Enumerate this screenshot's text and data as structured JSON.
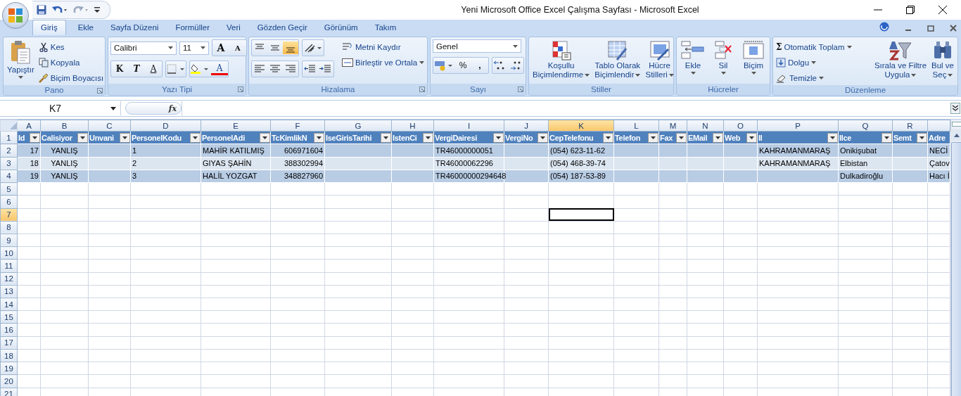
{
  "window": {
    "title": "Yeni Microsoft Office Excel Çalışma Sayfası - Microsoft Excel"
  },
  "tabs": [
    {
      "label": "Giriş",
      "selected": true
    },
    {
      "label": "Ekle",
      "selected": false
    },
    {
      "label": "Sayfa Düzeni",
      "selected": false
    },
    {
      "label": "Formüller",
      "selected": false
    },
    {
      "label": "Veri",
      "selected": false
    },
    {
      "label": "Gözden Geçir",
      "selected": false
    },
    {
      "label": "Görünüm",
      "selected": false
    },
    {
      "label": "Takım",
      "selected": false
    }
  ],
  "ribbon": {
    "clipboard": {
      "title": "Pano",
      "paste": "Yapıştır",
      "cut": "Kes",
      "copy": "Kopyala",
      "format_painter": "Biçim Boyacısı"
    },
    "font": {
      "title": "Yazı Tipi",
      "font_name": "Calibri",
      "font_size": "11",
      "grow": "A",
      "shrink": "A",
      "bold": "K",
      "italic": "T",
      "underline": "A",
      "font_color": "A"
    },
    "alignment": {
      "title": "Hizalama",
      "vertical": [
        {
          "kind": "top",
          "selected": false
        },
        {
          "kind": "middle",
          "selected": false
        },
        {
          "kind": "bottom",
          "selected": true
        }
      ],
      "horizontal": [
        {
          "kind": "left",
          "selected": false
        },
        {
          "kind": "center",
          "selected": false
        },
        {
          "kind": "right",
          "selected": false
        }
      ],
      "wrap": "Metni Kaydır",
      "merge": "Birleştir ve Ortala"
    },
    "number": {
      "title": "Sayı",
      "format": "Genel",
      "percent": "%",
      "comma": ","
    },
    "styles": {
      "title": "Stiller",
      "buttons": [
        {
          "kind": "conditional",
          "lines": [
            "Koşullu",
            "Biçimlendirme"
          ]
        },
        {
          "kind": "table",
          "lines": [
            "Tablo Olarak",
            "Biçimlendir"
          ]
        },
        {
          "kind": "cell",
          "lines": [
            "Hücre",
            "Stilleri"
          ]
        }
      ]
    },
    "cells": {
      "title": "Hücreler",
      "buttons": [
        {
          "kind": "insert",
          "label": "Ekle"
        },
        {
          "kind": "delete",
          "label": "Sil"
        },
        {
          "kind": "format",
          "label": "Biçim"
        }
      ]
    },
    "editing": {
      "title": "Düzenleme",
      "sigma": "Σ",
      "autosum": "Otomatik Toplam",
      "fill": "Dolgu",
      "clear": "Temizle",
      "sort": [
        "Sırala ve Filtre",
        "Uygula"
      ],
      "find": [
        "Bul ve",
        "Seç"
      ]
    }
  },
  "formula_bar": {
    "name_box": "K7",
    "fx": "fx"
  },
  "sheet": {
    "columns": [
      {
        "letter": "A",
        "header": "Id",
        "selected": false
      },
      {
        "letter": "B",
        "header": "Calisiyor",
        "selected": false
      },
      {
        "letter": "C",
        "header": "Unvani",
        "selected": false
      },
      {
        "letter": "D",
        "header": "PersonelKodu",
        "selected": false
      },
      {
        "letter": "E",
        "header": "PersonelAdi",
        "selected": false
      },
      {
        "letter": "F",
        "header": "TcKimlikN",
        "selected": false
      },
      {
        "letter": "G",
        "header": "IseGirisTarihi",
        "selected": false
      },
      {
        "letter": "H",
        "header": "IstenCi",
        "selected": false
      },
      {
        "letter": "I",
        "header": "VergiDairesi",
        "selected": false
      },
      {
        "letter": "J",
        "header": "VergiNo",
        "selected": false
      },
      {
        "letter": "K",
        "header": "CepTelefonu",
        "selected": true
      },
      {
        "letter": "L",
        "header": "Telefon",
        "selected": false
      },
      {
        "letter": "M",
        "header": "Fax",
        "selected": false
      },
      {
        "letter": "N",
        "header": "EMail",
        "selected": false
      },
      {
        "letter": "O",
        "header": "Web",
        "selected": false
      },
      {
        "letter": "P",
        "header": "Il",
        "selected": false
      },
      {
        "letter": "Q",
        "header": "Ilce",
        "selected": false
      },
      {
        "letter": "R",
        "header": "Semt",
        "selected": false
      },
      {
        "header": "Adre",
        "selected": false
      }
    ],
    "rows": [
      {
        "number": "2",
        "selected": false,
        "cells": [
          "17",
          "YANLIŞ",
          "",
          "1",
          "MAHİR KATILMIŞ",
          "606971604",
          "",
          "",
          "TR46000000051",
          "",
          "(054) 623-11-62",
          "",
          "",
          "",
          "",
          "KAHRAMANMARAŞ",
          "Onikişubat",
          "",
          "NECİ"
        ]
      },
      {
        "number": "3",
        "selected": false,
        "cells": [
          "18",
          "YANLIŞ",
          "",
          "2",
          "GIYAS ŞAHİN",
          "388302994",
          "",
          "",
          "TR46000062296",
          "",
          "(054) 468-39-74",
          "",
          "",
          "",
          "",
          "KAHRAMANMARAŞ",
          "Elbistan",
          "",
          "Çatov"
        ]
      },
      {
        "number": "4",
        "selected": false,
        "cells": [
          "19",
          "YANLIŞ",
          "",
          "3",
          "HALİL YOZGAT",
          "348827960",
          "",
          "",
          "TR46000000294648",
          "",
          "(054) 187-53-89",
          "",
          "",
          "",
          "",
          "",
          "Dulkadiroğlu",
          "",
          "Hacı İ"
        ]
      },
      {
        "number": "5",
        "selected": false
      },
      {
        "number": "6",
        "selected": false
      },
      {
        "number": "7",
        "selected": true
      },
      {
        "number": "8",
        "selected": false
      },
      {
        "number": "9",
        "selected": false
      },
      {
        "number": "10",
        "selected": false
      },
      {
        "number": "11",
        "selected": false
      },
      {
        "number": "12",
        "selected": false
      },
      {
        "number": "13",
        "selected": false
      },
      {
        "number": "14",
        "selected": false
      },
      {
        "number": "15",
        "selected": false
      },
      {
        "number": "16",
        "selected": false
      },
      {
        "number": "17",
        "selected": false
      },
      {
        "number": "18",
        "selected": false
      },
      {
        "number": "19",
        "selected": false
      },
      {
        "number": "20",
        "selected": false
      },
      {
        "number": "21",
        "selected": false
      }
    ],
    "header_row_number": "1"
  }
}
